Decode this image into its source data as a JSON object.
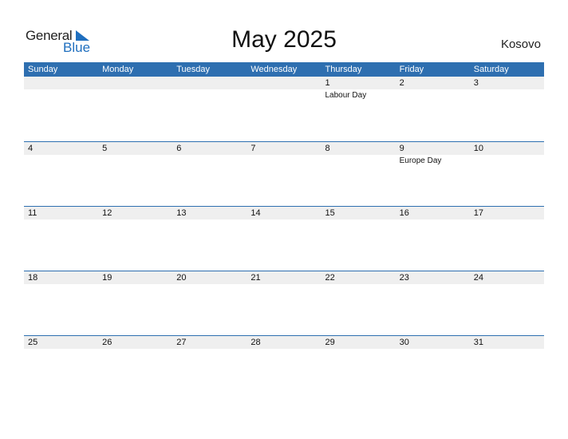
{
  "logo": {
    "word1": "General",
    "word2": "Blue"
  },
  "title": "May 2025",
  "country": "Kosovo",
  "colors": {
    "header": "#2e6fb0",
    "date_strip": "#efefef",
    "logo_blue": "#1f6fbf"
  },
  "weekdays": [
    "Sunday",
    "Monday",
    "Tuesday",
    "Wednesday",
    "Thursday",
    "Friday",
    "Saturday"
  ],
  "weeks": [
    {
      "days": [
        "",
        "",
        "",
        "",
        "1",
        "2",
        "3"
      ],
      "events": [
        "",
        "",
        "",
        "",
        "Labour Day",
        "",
        ""
      ]
    },
    {
      "days": [
        "4",
        "5",
        "6",
        "7",
        "8",
        "9",
        "10"
      ],
      "events": [
        "",
        "",
        "",
        "",
        "",
        "Europe Day",
        ""
      ]
    },
    {
      "days": [
        "11",
        "12",
        "13",
        "14",
        "15",
        "16",
        "17"
      ],
      "events": [
        "",
        "",
        "",
        "",
        "",
        "",
        ""
      ]
    },
    {
      "days": [
        "18",
        "19",
        "20",
        "21",
        "22",
        "23",
        "24"
      ],
      "events": [
        "",
        "",
        "",
        "",
        "",
        "",
        ""
      ]
    },
    {
      "days": [
        "25",
        "26",
        "27",
        "28",
        "29",
        "30",
        "31"
      ],
      "events": [
        "",
        "",
        "",
        "",
        "",
        "",
        ""
      ]
    }
  ]
}
